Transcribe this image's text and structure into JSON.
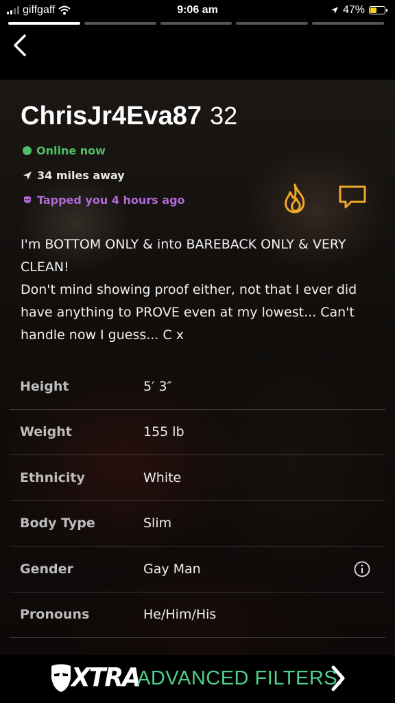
{
  "status_bar": {
    "carrier": "giffgaff",
    "time": "9:06 am",
    "battery_percent": "47%",
    "battery_level": 0.47,
    "signal_bars_on": 2,
    "signal_bars_total": 4,
    "icons": [
      "signal-icon",
      "wifi-icon",
      "location-arrow-icon",
      "battery-charging-icon"
    ]
  },
  "story_progress": {
    "segments": 5,
    "active": 1
  },
  "profile": {
    "display_name": "ChrisJr4Eva87",
    "age": "32",
    "online_status": "Online now",
    "distance": "34 miles away",
    "tapped": "Tapped you 4 hours ago",
    "bio": "I'm BOTTOM ONLY & into BAREBACK ONLY & VERY CLEAN!\nDon't mind showing proof either, not that I ever did have anything to PROVE even at my lowest... Can't handle now I guess... C x"
  },
  "attributes": [
    {
      "label": "Height",
      "value": "5′ 3″"
    },
    {
      "label": "Weight",
      "value": "155 lb"
    },
    {
      "label": "Ethnicity",
      "value": "White"
    },
    {
      "label": "Body Type",
      "value": "Slim"
    },
    {
      "label": "Gender",
      "value": "Gay Man",
      "has_info": true
    },
    {
      "label": "Pronouns",
      "value": "He/Him/His"
    }
  ],
  "banner": {
    "brand": "XTRA",
    "text": "ADVANCED FILTERS.",
    "accent": "#4fd08c"
  },
  "colors": {
    "online": "#4fc068",
    "tapped": "#b26ad8",
    "action_icons": "#f0a82a"
  }
}
